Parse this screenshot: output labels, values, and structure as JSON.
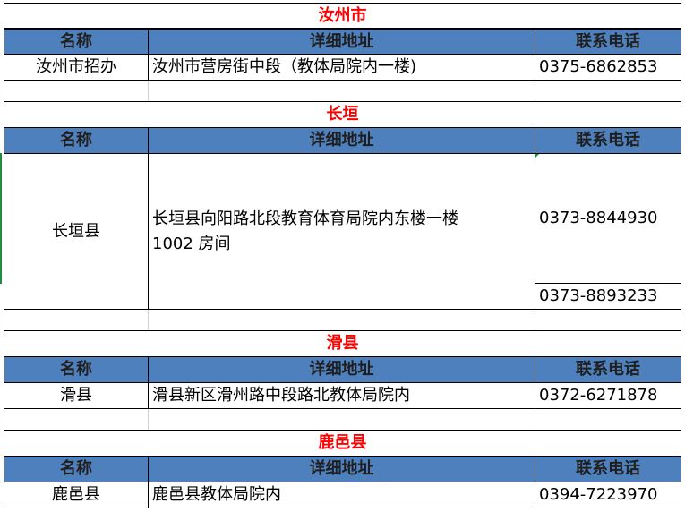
{
  "sections": [
    {
      "title": "汝州市",
      "headers": {
        "name": "名称",
        "address": "详细地址",
        "phone": "联系电话"
      },
      "row": {
        "name": "汝州市招办",
        "address": "汝州市营房街中段（教体局院内一楼)",
        "phones": [
          "0375-6862853"
        ]
      }
    },
    {
      "title": "长垣",
      "headers": {
        "name": "名称",
        "address": "详细地址",
        "phone": "联系电话"
      },
      "row": {
        "name": "长垣县",
        "address_line1": "长垣县向阳路北段教育体育局院内东楼一楼",
        "address_line2": "1002 房间",
        "phones": [
          "0373-8844930",
          "0373-8893233"
        ]
      }
    },
    {
      "title": "滑县",
      "headers": {
        "name": "名称",
        "address": "详细地址",
        "phone": "联系电话"
      },
      "row": {
        "name": "滑县",
        "address": "滑县新区滑州路中段路北教体局院内",
        "phones": [
          "0372-6271878"
        ]
      }
    },
    {
      "title": "鹿邑县",
      "headers": {
        "name": "名称",
        "address": "详细地址",
        "phone": "联系电话"
      },
      "row": {
        "name": "鹿邑县",
        "address": "鹿邑县教体局院内",
        "phones": [
          "0394-7223970"
        ]
      }
    }
  ],
  "colors": {
    "header_bg": "#4e80bd",
    "title_text": "#ff0000",
    "border": "#000000",
    "gridline": "#d0d0d0",
    "selection_green": "#1e8e3e"
  }
}
